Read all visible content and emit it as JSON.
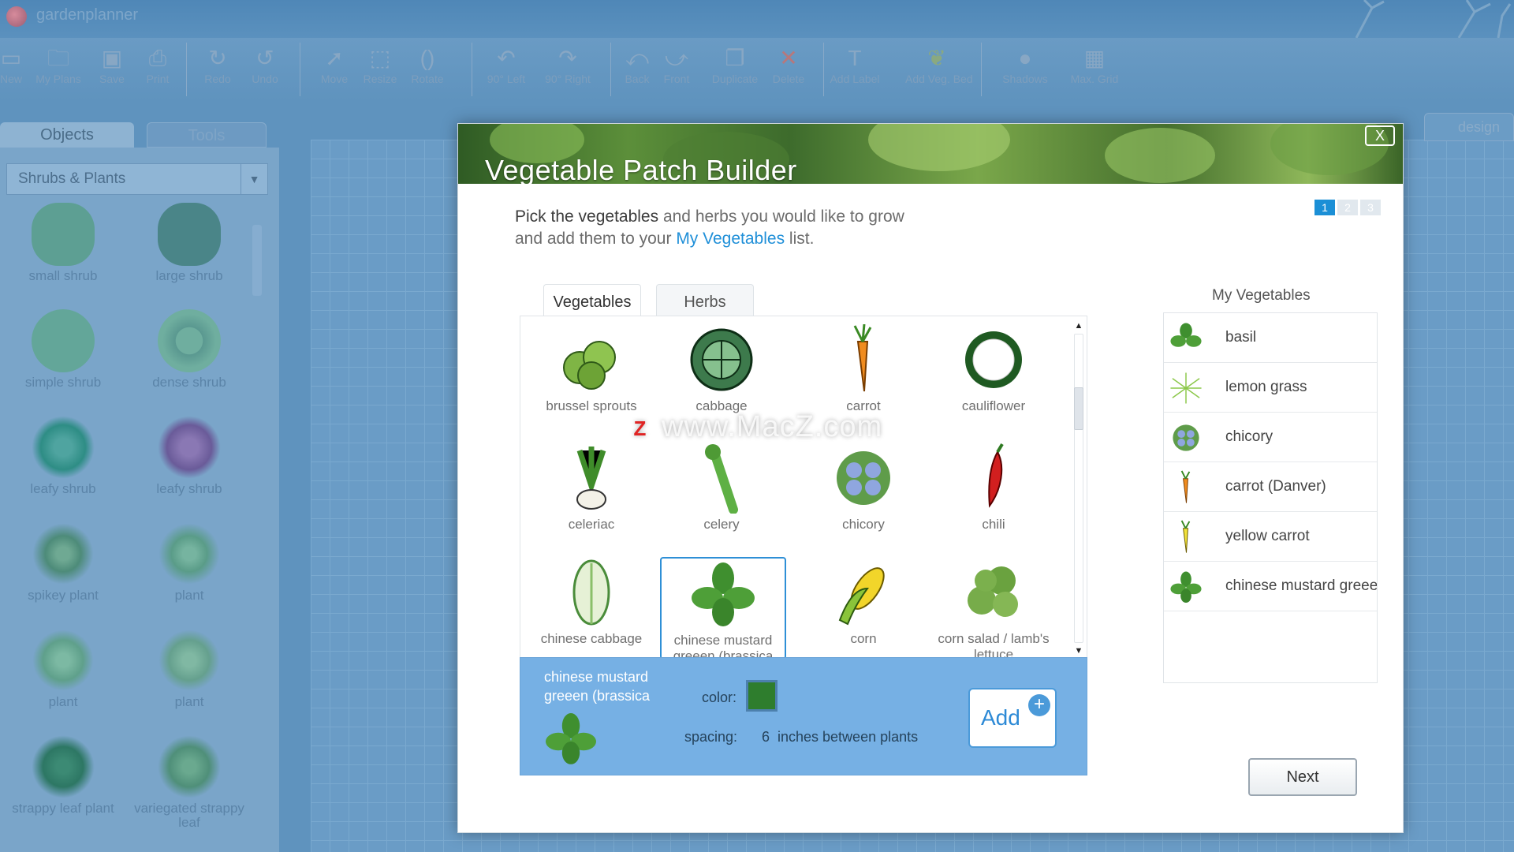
{
  "app": {
    "title": "gardenplanner"
  },
  "toolbar": [
    {
      "label": "New",
      "icon": "new-icon"
    },
    {
      "label": "My Plans",
      "icon": "folder-icon"
    },
    {
      "label": "Save",
      "icon": "save-icon"
    },
    {
      "label": "Print",
      "icon": "print-icon"
    },
    {
      "label": "Redo",
      "icon": "redo-icon"
    },
    {
      "label": "Undo",
      "icon": "undo-icon"
    },
    {
      "label": "Move",
      "icon": "cursor-icon"
    },
    {
      "label": "Resize",
      "icon": "resize-icon"
    },
    {
      "label": "Rotate",
      "icon": "rotate-icon"
    },
    {
      "label": "90° Left",
      "icon": "rotate-left-icon"
    },
    {
      "label": "90° Right",
      "icon": "rotate-right-icon"
    },
    {
      "label": "Back",
      "icon": "back-icon"
    },
    {
      "label": "Front",
      "icon": "front-icon"
    },
    {
      "label": "Duplicate",
      "icon": "duplicate-icon"
    },
    {
      "label": "Delete",
      "icon": "delete-icon"
    },
    {
      "label": "Add Label",
      "icon": "text-icon"
    },
    {
      "label": "Add Veg. Bed",
      "icon": "veg-bed-icon"
    },
    {
      "label": "Shadows",
      "icon": "shadow-icon"
    },
    {
      "label": "Max. Grid",
      "icon": "grid-icon"
    }
  ],
  "left": {
    "tabs": [
      "Objects",
      "Tools"
    ],
    "category": "Shrubs & Plants",
    "objects": [
      {
        "label": "small shrub"
      },
      {
        "label": "large shrub"
      },
      {
        "label": "simple shrub"
      },
      {
        "label": "dense shrub"
      },
      {
        "label": "leafy shrub"
      },
      {
        "label": "leafy shrub"
      },
      {
        "label": "spikey plant"
      },
      {
        "label": "plant"
      },
      {
        "label": "plant"
      },
      {
        "label": "plant"
      },
      {
        "label": "strappy leaf plant"
      },
      {
        "label": "variegated strappy leaf"
      }
    ]
  },
  "design_tab": "design",
  "modal": {
    "title": "Vegetable Patch Builder",
    "close": "X",
    "steps": [
      "1",
      "2",
      "3"
    ],
    "intro": {
      "bold": "Pick the vegetables",
      "rest1": " and herbs you would like to grow",
      "line2_prefix": "and add them to your ",
      "link": "My Vegetables",
      "line2_suffix": " list."
    },
    "tabs": [
      "Vegetables",
      "Herbs"
    ],
    "vegetables": [
      {
        "name": "brussel sprouts",
        "icon": "brussel-sprouts-icon"
      },
      {
        "name": "cabbage",
        "icon": "cabbage-icon"
      },
      {
        "name": "carrot",
        "icon": "carrot-icon"
      },
      {
        "name": "cauliflower",
        "icon": "cauliflower-icon"
      },
      {
        "name": "celeriac",
        "icon": "celeriac-icon"
      },
      {
        "name": "celery",
        "icon": "celery-icon"
      },
      {
        "name": "chicory",
        "icon": "chicory-icon"
      },
      {
        "name": "chili",
        "icon": "chili-icon"
      },
      {
        "name": "chinese cabbage",
        "icon": "chinese-cabbage-icon"
      },
      {
        "name": "chinese mustard greeen (brassica",
        "icon": "mustard-greens-icon"
      },
      {
        "name": "corn",
        "icon": "corn-icon"
      },
      {
        "name": "corn salad / lamb's lettuce",
        "icon": "corn-salad-icon"
      }
    ],
    "detail": {
      "name": "chinese mustard greeen (brassica",
      "color_label": "color:",
      "color": "#2e7d2d",
      "spacing_label": "spacing:",
      "spacing_value": "6",
      "spacing_unit": "inches between plants",
      "add_label": "Add",
      "add_plus": "+"
    },
    "my_vegetables": {
      "title": "My Vegetables",
      "items": [
        {
          "name": "basil",
          "icon": "basil-icon"
        },
        {
          "name": "lemon grass",
          "icon": "lemon-grass-icon"
        },
        {
          "name": "chicory",
          "icon": "chicory-icon"
        },
        {
          "name": "carrot (Danver)",
          "icon": "carrot-icon"
        },
        {
          "name": "yellow carrot",
          "icon": "yellow-carrot-icon"
        },
        {
          "name": "chinese mustard greee",
          "icon": "mustard-greens-icon"
        }
      ]
    },
    "next": "Next"
  },
  "watermark": {
    "badge": "Z",
    "text": "www.MacZ.com"
  }
}
